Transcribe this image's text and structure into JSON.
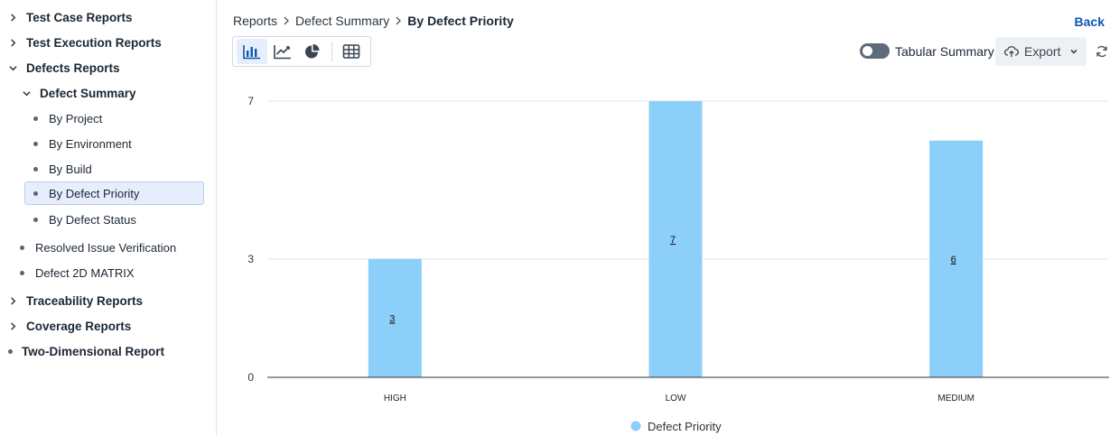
{
  "sidebar": {
    "items": [
      {
        "label": "Test Case Reports"
      },
      {
        "label": "Test Execution Reports"
      },
      {
        "label": "Defects Reports"
      },
      {
        "label": "Defect Summary"
      },
      {
        "label": "By Project"
      },
      {
        "label": "By Environment"
      },
      {
        "label": "By Build"
      },
      {
        "label": "By Defect Priority"
      },
      {
        "label": "By Defect Status"
      },
      {
        "label": "Resolved Issue Verification"
      },
      {
        "label": "Defect 2D MATRIX"
      },
      {
        "label": "Traceability Reports"
      },
      {
        "label": "Coverage Reports"
      },
      {
        "label": "Two-Dimensional Report"
      }
    ]
  },
  "header": {
    "breadcrumb": [
      "Reports",
      "Defect Summary",
      "By Defect Priority"
    ],
    "back_label": "Back"
  },
  "toolbar": {
    "chart_types": [
      {
        "icon": "bar-chart-icon",
        "active": true
      },
      {
        "icon": "line-chart-icon",
        "active": false
      },
      {
        "icon": "pie-chart-icon",
        "active": false
      },
      {
        "icon": "table-grid-icon",
        "active": false
      }
    ],
    "tabular_summary_label": "Tabular Summary",
    "tabular_summary_on": false,
    "export_label": "Export"
  },
  "colors": {
    "bar": "#8ccff9",
    "accent": "#0b57b4",
    "selected_bg": "#e6eefb"
  },
  "chart_data": {
    "type": "bar",
    "categories": [
      "HIGH",
      "LOW",
      "MEDIUM"
    ],
    "series": [
      {
        "name": "Defect Priority",
        "values": [
          3,
          7,
          6
        ]
      }
    ],
    "y_ticks": [
      0,
      3,
      7
    ],
    "ylim": [
      0,
      7
    ],
    "data_labels": [
      "3",
      "7",
      "6"
    ],
    "legend": {
      "position": "bottom",
      "label": "Defect Priority"
    },
    "grid": true
  }
}
